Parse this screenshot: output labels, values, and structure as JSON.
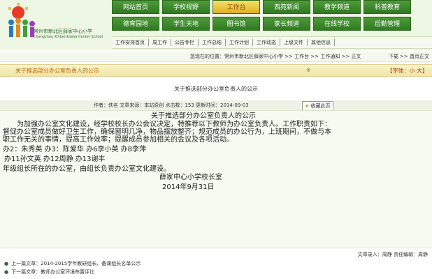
{
  "header": {
    "school_name": "常州市新北区薛家中心小学",
    "school_name_en": "Changzhou Xinbei Xuejia Center School"
  },
  "nav": {
    "row1": [
      "网站首页",
      "学校视野",
      "工作台",
      "西苑新闻",
      "教学频道",
      "科普教育"
    ],
    "row2": [
      "德育园地",
      "学生天地",
      "图书馆",
      "家长频道",
      "在线学校",
      "后勤管理"
    ],
    "active": "工作台"
  },
  "subnav": [
    "工作安排首页",
    "周工作",
    "公告专栏",
    "工作总结",
    "工作计划",
    "工作动态",
    "上级文件",
    "其他信息"
  ],
  "breadcrumb": {
    "left": "您现在的位置：常州市新北区薛家中心小学 >> 工作台 >> 工作通知 >> 正文",
    "right": "下载 >> 首页正文"
  },
  "titlebar": {
    "left": "关于推选部分办公室负责人的公示",
    "mark": "※",
    "right": "【字体：小 大】"
  },
  "article": {
    "title": "关于推选部分办公室负责人的公示",
    "meta": "作者：佚名    文章来源：本站原创    点击数：153    更新时间：2014-09-03",
    "favorite_label": "收藏此页",
    "content_title": "关于推选部分办公室负责人的公示",
    "paragraph1": "为加强办公室文化建设，经学校校长办公会议决定，特推荐以下教师为办公室负责人。工作职责如下：",
    "paragraph2": "督促办公室成员做好卫生工作，确保窗明几净，物品摆放整齐；规范成员的办公行为，上班期间，不做与本",
    "paragraph3": "职工作无关的事情，提高工作效率；提醒成员参加相关的会议及各项活动。",
    "line_offices1": "办2：朱秀英    办3：陈爱华    办6李小英    办8李萍",
    "line_offices2": "办11孙文英    办12周静    办13谢丰",
    "line_grade": "年级组长所在的办公室，由组长负责办公室文化建设。",
    "signature_org": "薛家中心小学校长室",
    "signature_date": "2014年9月31日",
    "footer_sign": "文章录入：周静    责任编辑：周静"
  },
  "prevnext": {
    "prev": "上一篇文章：2014-2015学年教研组长、备课组长名单公示",
    "next": "下一篇文章：教师办公室环境布置评比"
  },
  "colors": {
    "nav_green": "#2f7a22",
    "nav_active": "#e0b020",
    "title_orange": "#c06000",
    "header_bg": "#eef6e4"
  }
}
